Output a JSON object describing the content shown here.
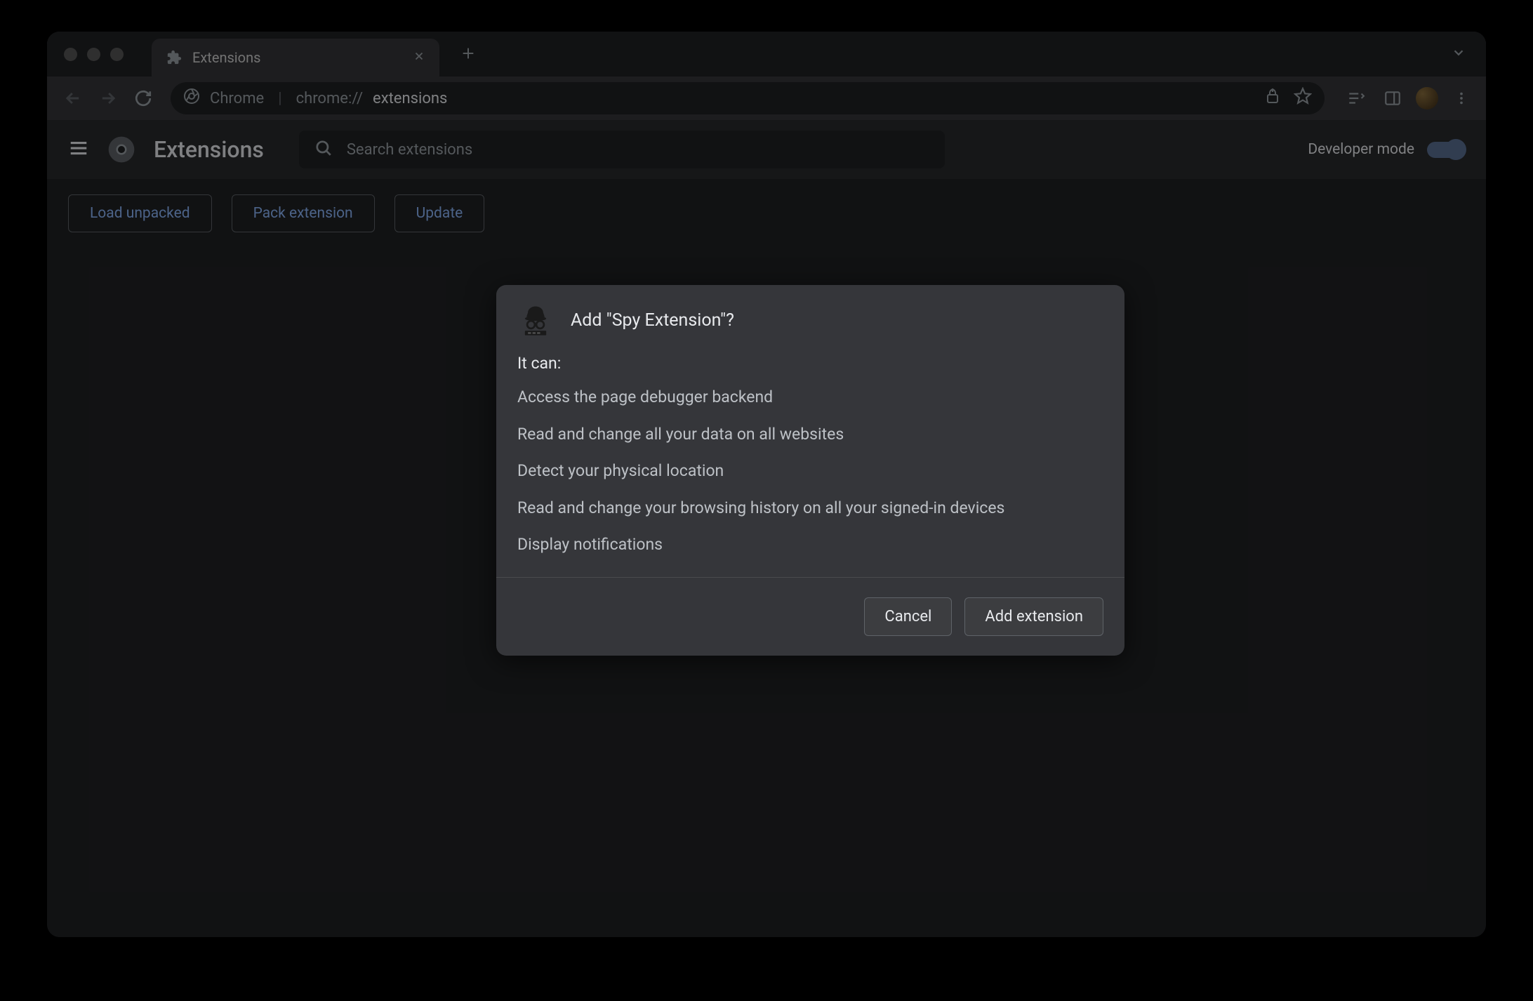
{
  "window": {
    "tab_title": "Extensions"
  },
  "omnibox": {
    "scheme_label": "Chrome",
    "url_prefix": "chrome://",
    "url_path": "extensions"
  },
  "header": {
    "title": "Extensions",
    "search_placeholder": "Search extensions",
    "dev_mode_label": "Developer mode"
  },
  "actions": {
    "load_unpacked": "Load unpacked",
    "pack_extension": "Pack extension",
    "update": "Update"
  },
  "dialog": {
    "title": "Add \"Spy Extension\"?",
    "subhead": "It can:",
    "permissions": [
      "Access the page debugger backend",
      "Read and change all your data on all websites",
      "Detect your physical location",
      "Read and change your browsing history on all your signed-in devices",
      "Display notifications"
    ],
    "cancel": "Cancel",
    "confirm": "Add extension"
  }
}
